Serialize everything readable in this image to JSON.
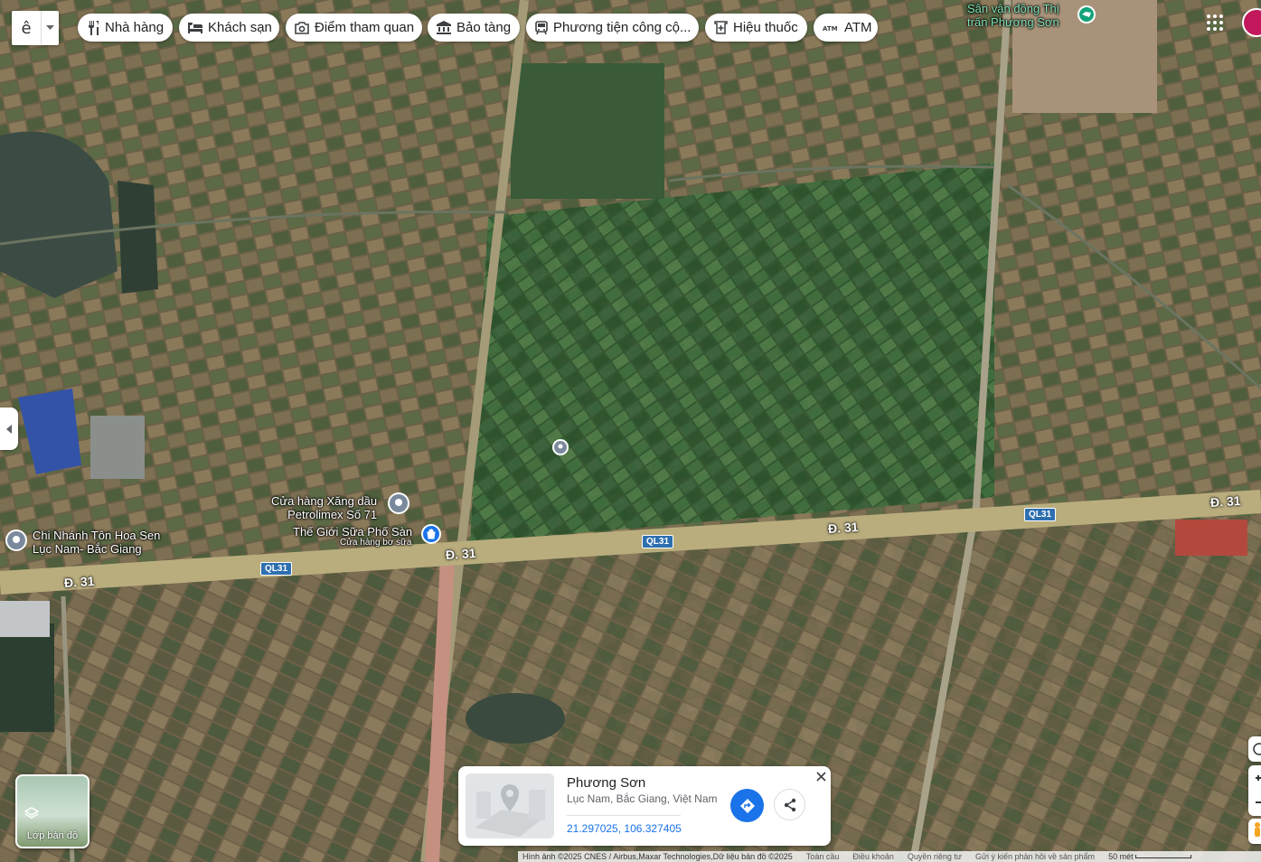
{
  "toolbar": {
    "language_char": "ê",
    "chips": [
      {
        "label": "Nhà hàng",
        "icon": "restaurant-icon"
      },
      {
        "label": "Khách sạn",
        "icon": "hotel-icon"
      },
      {
        "label": "Điểm tham quan",
        "icon": "camera-icon"
      },
      {
        "label": "Bảo tàng",
        "icon": "museum-icon"
      },
      {
        "label": "Phương tiện công cộ...",
        "icon": "transit-icon"
      },
      {
        "label": "Hiệu thuốc",
        "icon": "pharmacy-icon"
      },
      {
        "label": "ATM",
        "icon": "atm-icon"
      }
    ]
  },
  "places": {
    "stadium": {
      "line1": "Sân vận động Thị",
      "line2": "trấn Phương Sơn"
    },
    "petrol": {
      "line1": "Cửa hàng Xăng dầu",
      "line2": "Petrolimex Số 71"
    },
    "milk": {
      "name": "Thế Giới Sữa Phố Sàn",
      "sub": "Cửa hàng bơ sữa"
    },
    "hoasen": {
      "line1": "Chi Nhánh Tôn Hoa Sen",
      "line2": "Lục Nam- Bắc Giang"
    }
  },
  "roads": {
    "d31": "Đ. 31",
    "ql31": "QL31"
  },
  "layers": {
    "label": "Lớp bản đồ"
  },
  "card": {
    "title": "Phương Sơn",
    "address": "Lục Nam, Bắc Giang, Việt Nam",
    "coords": "21.297025, 106.327405"
  },
  "footer": {
    "imagery": "Hình ảnh ©2025 CNES / Airbus,Maxar Technologies,Dữ liệu bản đồ ©2025",
    "global": "Toàn cầu",
    "terms": "Điều khoản",
    "privacy": "Quyền riêng tư",
    "feedback": "Gửi ý kiến phản hồi về sản phẩm",
    "scale": "50 mét"
  },
  "colors": {
    "accent": "#1a73e8",
    "road": "#b9ad7e",
    "field_green": "#3f6b3a",
    "field_brown": "#7a6a4e"
  }
}
